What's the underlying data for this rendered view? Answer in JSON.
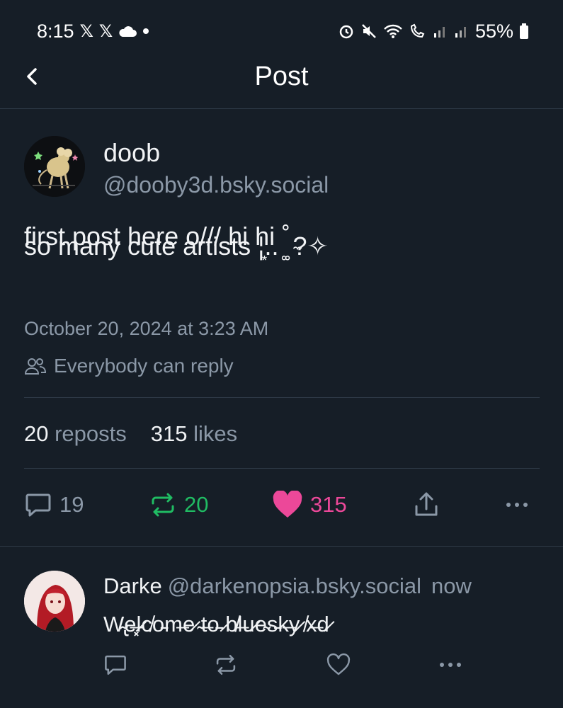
{
  "status_bar": {
    "time": "8:15",
    "battery": "55%",
    "icons": [
      "x-icon",
      "x-icon",
      "cloud-icon",
      "dot-icon",
      "alarm-icon",
      "mute-icon",
      "wifi-icon",
      "wifi-call-icon",
      "signal-icon",
      "signal-icon",
      "battery-icon"
    ]
  },
  "header": {
    "title": "Post",
    "back_icon": "chevron-left-icon"
  },
  "post": {
    "author": {
      "name": "doob",
      "handle": "@dooby3d.bsky.social"
    },
    "text_line1": "first post here o/// hi hi ˚ ̼",
    "text_line2": "so many cute artists ¦͙.. ͚͚ ?✧",
    "date": "October 20, 2024 at 3:23 AM",
    "reply_setting": "Everybody can reply",
    "stats": {
      "reposts_count": "20",
      "reposts_label": "reposts",
      "likes_count": "315",
      "likes_label": "likes"
    },
    "actions": {
      "reply_count": "19",
      "repost_count": "20",
      "like_count": "315"
    }
  },
  "reply": {
    "author_name": "Darke",
    "author_handle": "@darkenopsia.bsky.social",
    "time": "now",
    "text": "W̴̢e̶͓l̷c̸o̵m̶e̷ ̴t̶o̵ ̷b̸l̶u̷e̴s̵k̶y̷ ̸x̶d̷"
  },
  "colors": {
    "background": "#161e27",
    "text_primary": "#f1f3f5",
    "text_secondary": "#8b98a7",
    "repost_green": "#20bc63",
    "like_pink": "#ec4899",
    "divider": "#2e3a47"
  }
}
